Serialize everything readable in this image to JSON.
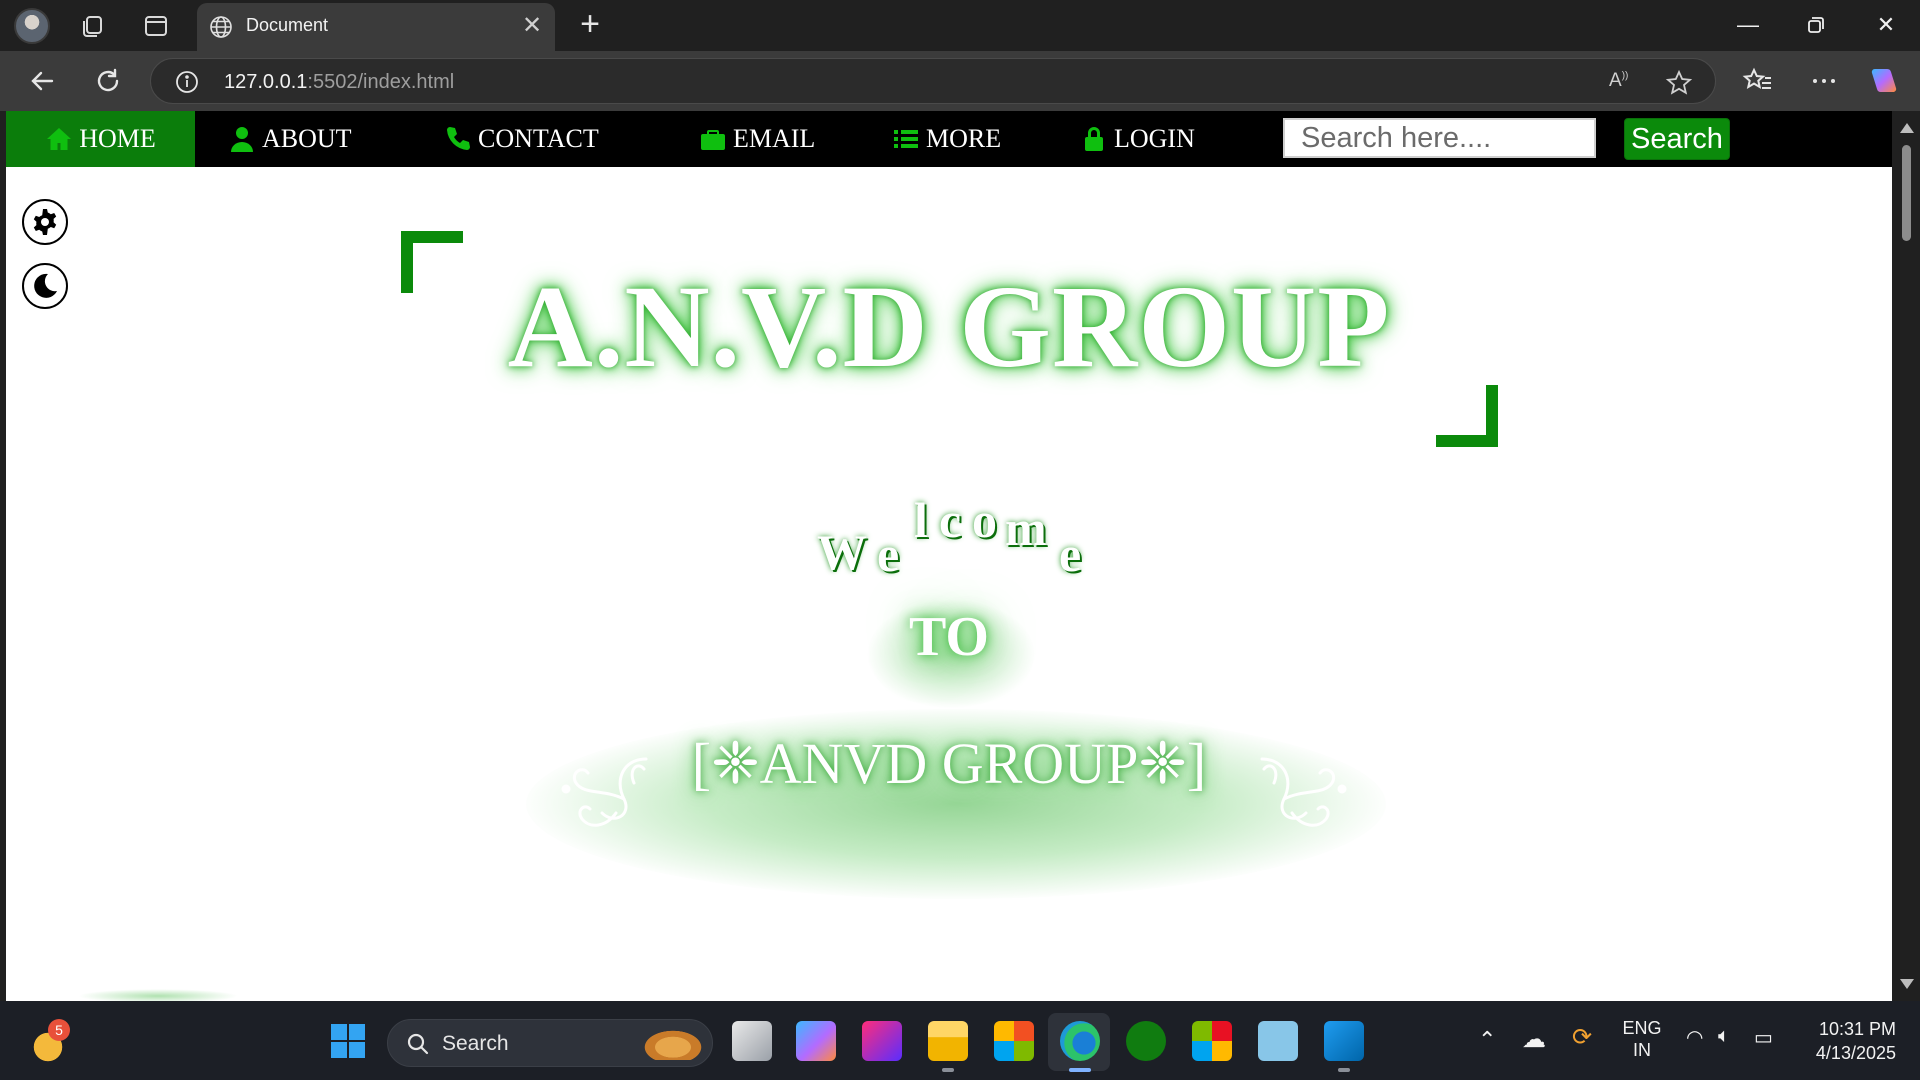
{
  "browser": {
    "tab_title": "Document",
    "url_host": "127.0.0.1",
    "url_rest": ":5502/index.html"
  },
  "site": {
    "nav": [
      {
        "label": "HOME",
        "icon": "home-icon",
        "active": true
      },
      {
        "label": "ABOUT",
        "icon": "user-icon"
      },
      {
        "label": "CONTACT",
        "icon": "phone-icon"
      },
      {
        "label": "EMAIL",
        "icon": "briefcase-icon"
      },
      {
        "label": "MORE",
        "icon": "list-icon"
      },
      {
        "label": "LOGIN",
        "icon": "lock-icon"
      }
    ],
    "search_placeholder": "Search here....",
    "search_button": "Search",
    "brand_title": "A.N.V.D GROUP",
    "welcome_letters": [
      "W",
      "e",
      "l",
      "c",
      "o",
      "m",
      "e"
    ],
    "to_text": "TO",
    "group_title": "[❈ANVD GROUP❈]",
    "accent_color": "#0b8a0b"
  },
  "taskbar": {
    "widget_badge": "5",
    "search_label": "Search",
    "lang_line1": "ENG",
    "lang_line2": "IN",
    "time": "10:31 PM",
    "date": "4/13/2025"
  }
}
